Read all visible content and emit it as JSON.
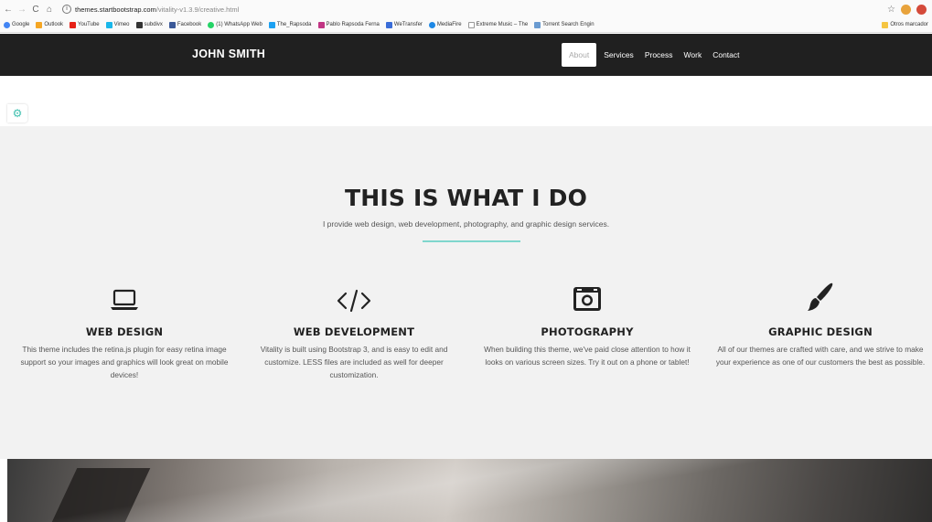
{
  "browser": {
    "url_host": "themes.startbootstrap.com",
    "url_path": "/vitality-v1.3.9/creative.html",
    "bookmarks": [
      "Google",
      "Outlook",
      "YouTube",
      "Vimeo",
      "subdivx",
      "Facebook",
      "(1) WhatsApp Web",
      "The_Rapsoda",
      "Pablo Rapsoda Ferna",
      "WeTransfer",
      "MediaFire",
      "Extreme Music – The",
      "Torrent Search Engin"
    ],
    "other_bookmarks": "Otros marcador"
  },
  "navbar": {
    "brand": "JOHN SMITH",
    "links": [
      "About",
      "Services",
      "Process",
      "Work",
      "Contact"
    ]
  },
  "services": {
    "title": "THIS IS WHAT I DO",
    "subtitle": "I provide web design, web development, photography, and graphic design services.",
    "items": [
      {
        "icon": "laptop-icon",
        "title": "WEB DESIGN",
        "text": "This theme includes the retina.js plugin for easy retina image support so your images and graphics will look great on mobile devices!"
      },
      {
        "icon": "code-icon",
        "title": "WEB DEVELOPMENT",
        "text": "Vitality is built using Bootstrap 3, and is easy to edit and customize. LESS files are included as well for deeper customization."
      },
      {
        "icon": "camera-icon",
        "title": "PHOTOGRAPHY",
        "text": "When building this theme, we've paid close attention to how it looks on various screen sizes. Try it out on a phone or tablet!"
      },
      {
        "icon": "paint-brush-icon",
        "title": "GRAPHIC DESIGN",
        "text": "All of our themes are crafted with care, and we strive to make your experience as one of our customers the best as possible."
      }
    ]
  },
  "colors": {
    "navbar": "#202020",
    "accent": "#3dbfae",
    "divider": "#7fd6cd",
    "section_bg": "#f2f2f2"
  }
}
